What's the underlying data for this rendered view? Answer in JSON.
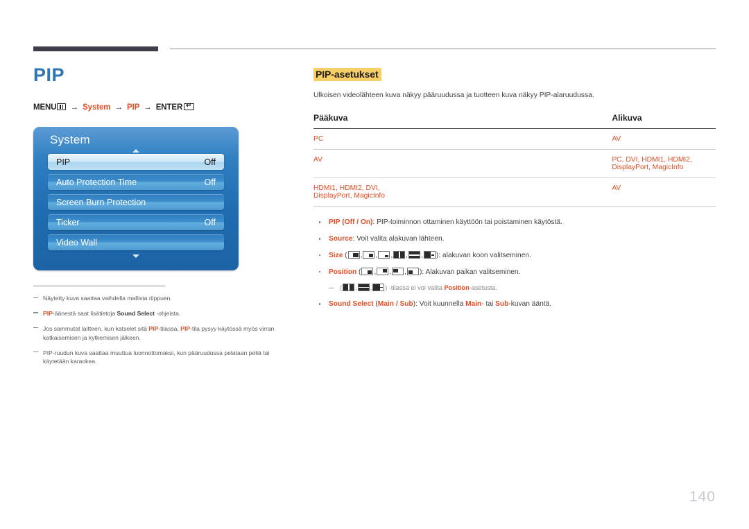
{
  "header": {
    "bar_label": "header-bar",
    "rule_label": "header-rule"
  },
  "left": {
    "title": "PIP",
    "menu_path": {
      "menu_label": "MENU",
      "arrow": "→",
      "system_label": "System",
      "pip_label": "PIP",
      "enter_label": "ENTER"
    },
    "osd": {
      "title": "System",
      "rows": [
        {
          "label": "PIP",
          "value": "Off",
          "selected": true
        },
        {
          "label": "Auto Protection Time",
          "value": "Off",
          "selected": false
        },
        {
          "label": "Screen Burn Protection",
          "value": "",
          "selected": false
        },
        {
          "label": "Ticker",
          "value": "Off",
          "selected": false
        },
        {
          "label": "Video Wall",
          "value": "",
          "selected": false
        }
      ],
      "scroll_up_icon": "caret-up-icon",
      "scroll_down_icon": "caret-down-icon"
    },
    "notes": [
      {
        "parts": [
          {
            "t": "Näytetty kuva saattaa vaihdella mallista riippuen.",
            "s": "n"
          }
        ]
      },
      {
        "parts": [
          {
            "t": "PIP",
            "s": "b"
          },
          {
            "t": "-äänestä saat lisätietoja ",
            "s": "n"
          },
          {
            "t": "Sound Select",
            "s": "k"
          },
          {
            "t": " -ohjeista.",
            "s": "n"
          }
        ]
      },
      {
        "parts": [
          {
            "t": "Jos sammutat laitteen, kun katselet sitä ",
            "s": "n"
          },
          {
            "t": "PIP",
            "s": "b"
          },
          {
            "t": "-tilassa, ",
            "s": "n"
          },
          {
            "t": "PIP",
            "s": "b"
          },
          {
            "t": "-tila pysyy käytössä myös virran katkaisemisen ja kytkemisen jälkeen.",
            "s": "n"
          }
        ]
      },
      {
        "parts": [
          {
            "t": "PIP-ruudun kuva saattaa muuttua luonnottomaksi, kun pääruudussa pelataan peliä tai käytetään karaokea.",
            "s": "n"
          }
        ]
      }
    ]
  },
  "right": {
    "section_title": "PIP-asetukset",
    "intro": "Ulkoisen videolähteen kuva näkyy pääruudussa ja tuotteen kuva näkyy PIP-alaruudussa.",
    "table": {
      "headers": [
        "Pääkuva",
        "Alikuva"
      ],
      "rows": [
        [
          "PC",
          "AV"
        ],
        [
          "AV",
          "PC, DVI, HDMI1, HDMI2, DisplayPort, MagicInfo"
        ],
        [
          "HDMI1, HDMI2, DVI, DisplayPort, MagicInfo",
          "AV"
        ]
      ]
    },
    "bullets": {
      "pip": {
        "name": "PIP",
        "options": "(Off / On)",
        "opt_off": "Off",
        "opt_sep": " / ",
        "opt_on": "On",
        "desc": ": PIP-toiminnon ottaminen käyttöön tai poistaminen käytöstä."
      },
      "source": {
        "name": "Source",
        "desc": ": Voit valita alakuvan lähteen."
      },
      "size": {
        "name": "Size",
        "open": " (",
        "close": "): alakuvan koon valitseminen.",
        "icons": [
          "pip-size-large-icon",
          "pip-size-medium-icon",
          "pip-size-small-icon",
          "pip-split-vertical-icon",
          "pip-split-horizontal-icon",
          "pip-split-wide-icon"
        ]
      },
      "position": {
        "name": "Position",
        "open": " (",
        "close": "): Alakuvan paikan valitseminen.",
        "icons": [
          "pip-pos-bottom-right-icon",
          "pip-pos-top-right-icon",
          "pip-pos-top-left-icon",
          "pip-pos-bottom-left-icon"
        ]
      },
      "position_note": {
        "open": "(",
        "close": ") -tilassa ei voi valita ",
        "name": "Position",
        "tail": "-asetusta.",
        "icons": [
          "pip-split-vertical-icon",
          "pip-split-horizontal-icon",
          "pip-split-wide-icon"
        ]
      },
      "sound": {
        "name": "Sound Select",
        "open": " (",
        "main": "Main",
        "sep": " / ",
        "sub": "Sub",
        "close": "): Voit kuunnella ",
        "main2": "Main",
        "mid": "- tai ",
        "sub2": "Sub",
        "tail": "-kuvan ääntä."
      }
    }
  },
  "footer": {
    "page_number": "140"
  },
  "colors": {
    "accent_orange": "#e04e23",
    "title_blue": "#2e75b6",
    "highlight_yellow": "#f6cf67",
    "osd_blue": "#2f7fc1",
    "header_bar": "#413c4b"
  }
}
